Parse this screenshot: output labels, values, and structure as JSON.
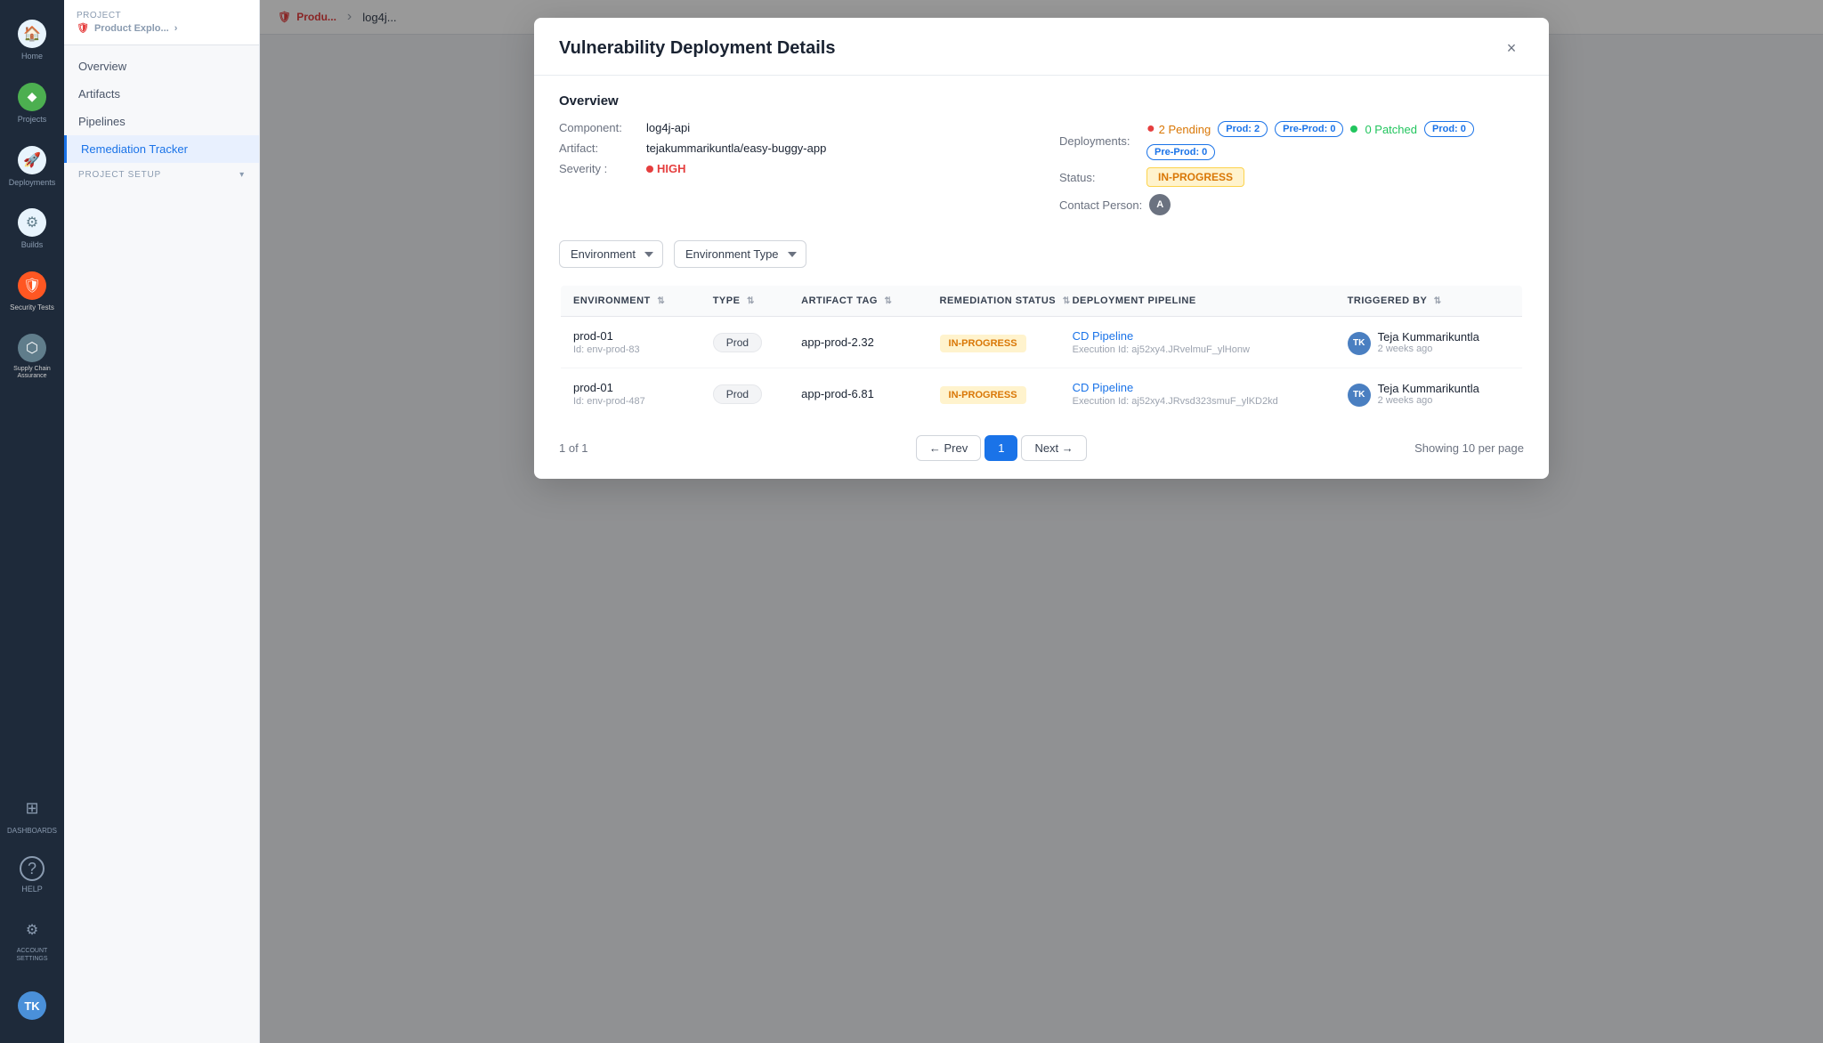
{
  "sidebar": {
    "icons": [
      {
        "name": "home",
        "label": "Home",
        "icon": "🏠",
        "active": false
      },
      {
        "name": "projects",
        "label": "Projects",
        "icon": "◆",
        "active": false
      },
      {
        "name": "deployments",
        "label": "Deployments",
        "icon": "🚀",
        "active": false
      },
      {
        "name": "builds",
        "label": "Builds",
        "icon": "⚙",
        "active": false
      },
      {
        "name": "security",
        "label": "Security Tests",
        "icon": "🛡",
        "active": false
      },
      {
        "name": "supply-chain",
        "label": "Supply Chain Assurance",
        "icon": "⬡",
        "active": false
      },
      {
        "name": "grid",
        "label": "",
        "icon": "⊞",
        "active": false
      },
      {
        "name": "help",
        "label": "HELP",
        "icon": "?",
        "active": false
      },
      {
        "name": "account-settings",
        "label": "ACCOUNT SETTINGS",
        "icon": "⚙",
        "active": false
      }
    ],
    "account_initials": "TK"
  },
  "nav": {
    "project_label": "Project",
    "project_name": "Product Explo...",
    "items": [
      {
        "label": "Overview",
        "active": false
      },
      {
        "label": "Artifacts",
        "active": false
      },
      {
        "label": "Pipelines",
        "active": false
      },
      {
        "label": "Remediation Tracker",
        "active": true
      }
    ],
    "section_label": "PROJECT SETUP"
  },
  "breadcrumb": {
    "product": "Produ...",
    "page": "log4j..."
  },
  "modal": {
    "title": "Vulnerability Deployment Details",
    "close_label": "×",
    "overview_title": "Overview",
    "component_label": "Component:",
    "component_value": "log4j-api",
    "artifact_label": "Artifact:",
    "artifact_value": "tejakummarikuntla/easy-buggy-app",
    "severity_label": "Severity :",
    "severity_value": "HIGH",
    "deployments_label": "Deployments:",
    "deployments_pending": "2 Pending",
    "prod_2_label": "Prod: 2",
    "preprod_0_label": "Pre-Prod: 0",
    "patched_label": "0 Patched",
    "prod_0_label": "Prod: 0",
    "preprod_0b_label": "Pre-Prod: 0",
    "status_label": "Status:",
    "status_value": "IN-PROGRESS",
    "contact_label": "Contact Person:",
    "contact_initial": "A",
    "env_filter_label": "Environment",
    "env_type_label": "Environment Type",
    "table": {
      "headers": [
        {
          "label": "ENVIRONMENT",
          "key": "environment"
        },
        {
          "label": "TYPE",
          "key": "type"
        },
        {
          "label": "ARTIFACT TAG",
          "key": "artifact_tag"
        },
        {
          "label": "REMEDIATION STATUS",
          "key": "remediation_status"
        },
        {
          "label": "DEPLOYMENT PIPELINE",
          "key": "deployment_pipeline"
        },
        {
          "label": "TRIGGERED BY",
          "key": "triggered_by"
        }
      ],
      "rows": [
        {
          "env_name": "prod-01",
          "env_id": "Id: env-prod-83",
          "type": "Prod",
          "artifact_tag": "app-prod-2.32",
          "status": "IN-PROGRESS",
          "pipeline_name": "CD Pipeline",
          "execution_id": "Execution Id: aj52xy4.JRvelmuF_ylHonw",
          "triggered_by": "Teja Kummarikuntla",
          "triggered_time": "2 weeks ago",
          "avatar_initials": "TK"
        },
        {
          "env_name": "prod-01",
          "env_id": "Id: env-prod-487",
          "type": "Prod",
          "artifact_tag": "app-prod-6.81",
          "status": "IN-PROGRESS",
          "pipeline_name": "CD Pipeline",
          "execution_id": "Execution Id: aj52xy4.JRvsd323smuF_ylKD2kd",
          "triggered_by": "Teja Kummarikuntla",
          "triggered_time": "2 weeks ago",
          "avatar_initials": "TK"
        }
      ]
    },
    "pagination": {
      "current_range": "1 of 1",
      "prev_label": "← Prev",
      "page_1": "1",
      "next_label": "Next →",
      "per_page": "Showing 10 per page"
    }
  }
}
